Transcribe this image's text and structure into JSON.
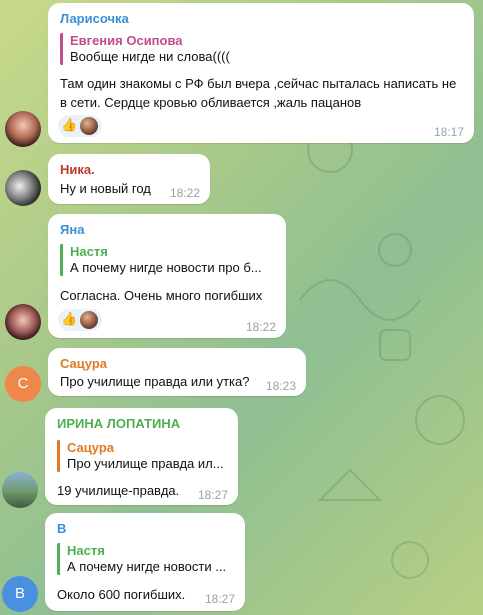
{
  "messages": [
    {
      "sender": "Ларисочка",
      "sender_color": "#3a8fd6",
      "quote": {
        "name": "Евгения Осипова",
        "text": "Вообще нигде ни слова((((",
        "color": "#c44b8c"
      },
      "text_lines": [
        "Там один знакомы с РФ был вчера ,сейчас пыталась написать не",
        "в сети. Сердце кровью обливается ,жаль пацанов"
      ],
      "reaction": "👍",
      "time": "18:17"
    },
    {
      "sender": "Ника.",
      "sender_color": "#c0392b",
      "text_lines": [
        "Ну и новый год"
      ],
      "time": "18:22"
    },
    {
      "sender": "Яна",
      "sender_color": "#3a8fd6",
      "quote": {
        "name": "Настя",
        "text": "А почему нигде новости про б...",
        "color": "#4caf50"
      },
      "text_lines": [
        "Согласна. Очень много погибших"
      ],
      "reaction": "👍",
      "time": "18:22"
    },
    {
      "sender": "Сацура",
      "sender_color": "#e07b22",
      "text_lines": [
        "Про училище правда или утка?"
      ],
      "time": "18:23",
      "avatar_letter": "С",
      "avatar_color": "#f0874a"
    },
    {
      "sender": "ИРИНА ЛОПАТИНА",
      "sender_color": "#4caf50",
      "quote": {
        "name": "Сацура",
        "text": "Про училище правда ил...",
        "color": "#e07b22"
      },
      "text_lines": [
        "19 училище-правда."
      ],
      "time": "18:27"
    },
    {
      "sender": "В",
      "sender_color": "#3a8fd6",
      "quote": {
        "name": "Настя",
        "text": "А почему нигде новости ...",
        "color": "#4caf50"
      },
      "text_lines": [
        "Около 600 погибших."
      ],
      "time": "18:27",
      "avatar_letter": "В",
      "avatar_color": "#4a8fe0"
    }
  ]
}
